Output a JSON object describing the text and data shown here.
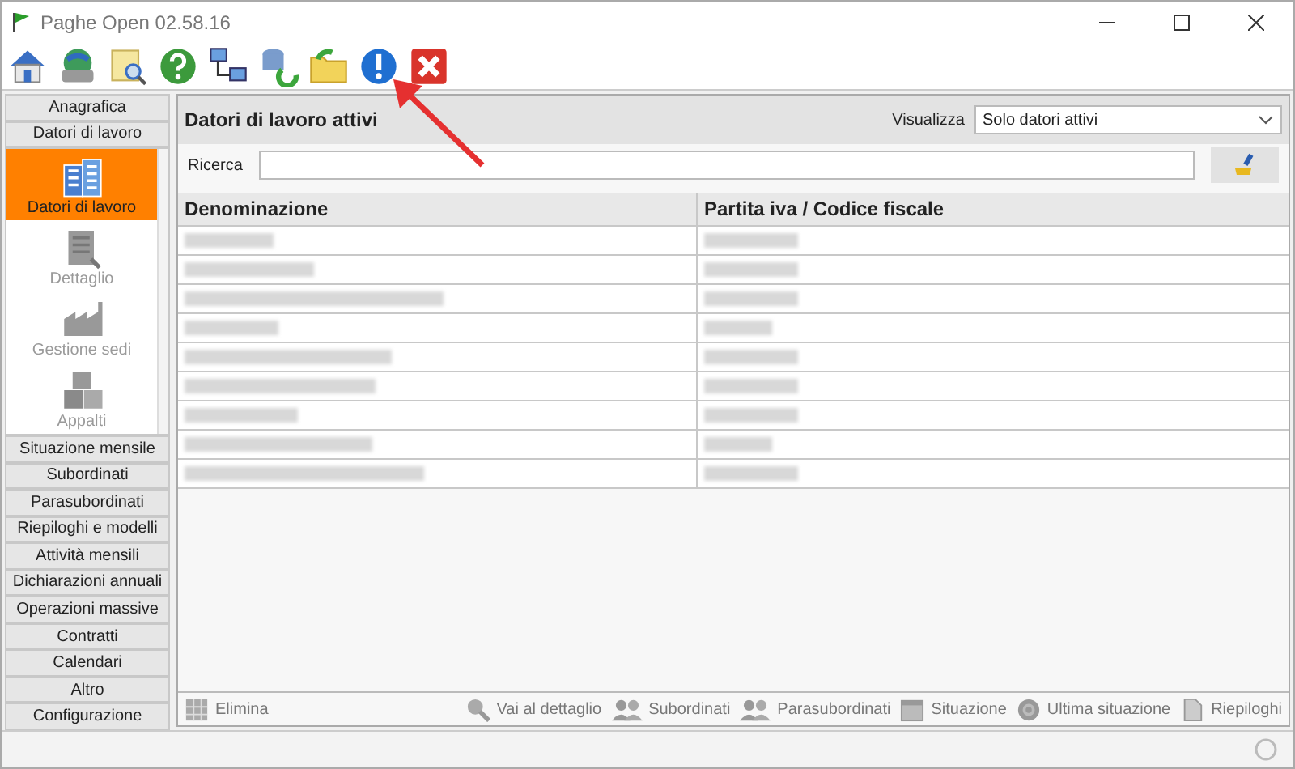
{
  "window": {
    "title": "Paghe Open 02.58.16"
  },
  "toolbar": [
    {
      "kind": "home"
    },
    {
      "kind": "globe-printer"
    },
    {
      "kind": "search-doc"
    },
    {
      "kind": "help"
    },
    {
      "kind": "network"
    },
    {
      "kind": "sync"
    },
    {
      "kind": "folder"
    },
    {
      "kind": "info"
    },
    {
      "kind": "close"
    }
  ],
  "annotation": {
    "kind": "arrow"
  },
  "sidebar": {
    "sections": [
      {
        "label": "Anagrafica"
      },
      {
        "label": "Datori di lavoro",
        "children": [
          {
            "label": "Datori di lavoro",
            "kind": "buildings",
            "selected": true,
            "disabled": false
          },
          {
            "label": "Dettaglio",
            "kind": "building-search",
            "selected": false,
            "disabled": true
          },
          {
            "label": "Gestione sedi",
            "kind": "factory",
            "selected": false,
            "disabled": true
          },
          {
            "label": "Appalti",
            "kind": "boxes",
            "selected": false,
            "disabled": true
          }
        ]
      },
      {
        "label": "Situazione mensile"
      },
      {
        "label": "Subordinati"
      },
      {
        "label": "Parasubordinati"
      },
      {
        "label": "Riepiloghi e modelli"
      },
      {
        "label": "Attività mensili"
      },
      {
        "label": "Dichiarazioni annuali"
      },
      {
        "label": "Operazioni massive"
      },
      {
        "label": "Contratti"
      },
      {
        "label": "Calendari"
      },
      {
        "label": "Altro"
      },
      {
        "label": "Configurazione"
      }
    ]
  },
  "main": {
    "title": "Datori di lavoro attivi",
    "view_label": "Visualizza",
    "view_value": "Solo datori attivi",
    "search_label": "Ricerca",
    "table": {
      "columns": [
        "Denominazione",
        "Partita iva / Codice fiscale"
      ],
      "rows": [
        {
          "redacted": true
        },
        {
          "redacted": true
        },
        {
          "redacted": true
        },
        {
          "redacted": true
        },
        {
          "redacted": true
        },
        {
          "redacted": true
        },
        {
          "redacted": true
        },
        {
          "redacted": true
        },
        {
          "redacted": true
        }
      ]
    },
    "actions": [
      {
        "label": "Elimina",
        "kind": "grid",
        "disabled": true
      },
      {
        "label": "Vai al dettaglio",
        "kind": "magnifier",
        "disabled": true
      },
      {
        "label": "Subordinati",
        "kind": "people",
        "disabled": true
      },
      {
        "label": "Parasubordinati",
        "kind": "people",
        "disabled": true
      },
      {
        "label": "Situazione",
        "kind": "calendar",
        "disabled": true
      },
      {
        "label": "Ultima situazione",
        "kind": "target",
        "disabled": true
      },
      {
        "label": "Riepiloghi",
        "kind": "document",
        "disabled": true
      }
    ]
  }
}
